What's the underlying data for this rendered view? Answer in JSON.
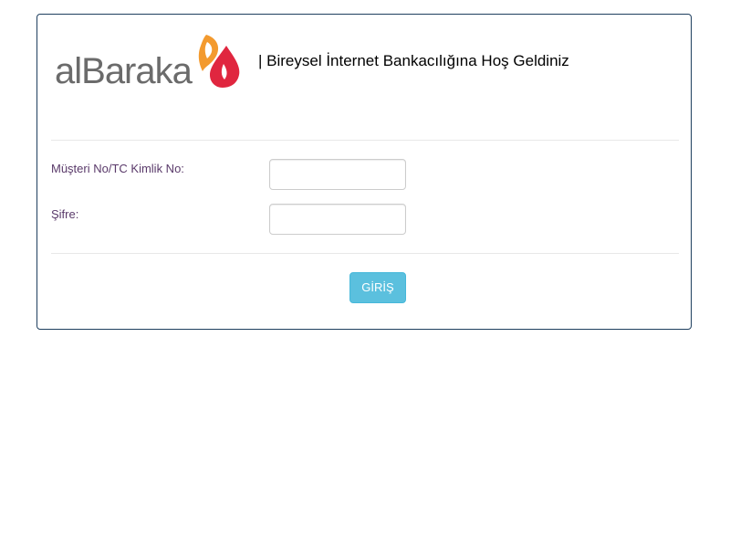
{
  "brand": {
    "wordmark": "alBaraka",
    "wordmark_color": "#6b6b6b",
    "mark_colors": [
      "#f39a2e",
      "#e0263f"
    ]
  },
  "header": {
    "welcome_text": "| Bireysel İnternet Bankacılığına Hoş Geldiniz"
  },
  "form": {
    "customer_id_label": "Müşteri No/TC Kimlik No:",
    "customer_id_value": "",
    "password_label": "Şifre:",
    "password_value": "",
    "submit_label": "GİRİŞ"
  },
  "colors": {
    "panel_border": "#1f3f5f",
    "label_text": "#5a3a6a",
    "button_bg": "#5bc0de"
  }
}
